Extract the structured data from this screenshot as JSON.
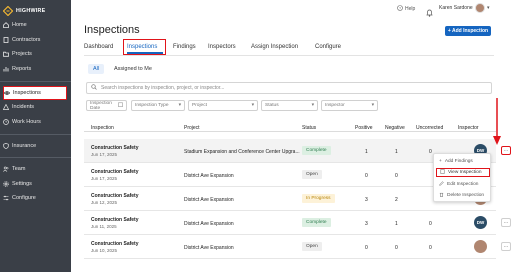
{
  "brand": {
    "name": "HIGHWIRE"
  },
  "sidebar": {
    "items": [
      {
        "label": "Home",
        "icon": "home-icon"
      },
      {
        "label": "Contractors",
        "icon": "building-icon"
      },
      {
        "label": "Projects",
        "icon": "folder-icon"
      },
      {
        "label": "Reports",
        "icon": "chart-icon"
      },
      {
        "label": "Inspections",
        "icon": "eye-icon"
      },
      {
        "label": "Incidents",
        "icon": "alert-icon"
      },
      {
        "label": "Work Hours",
        "icon": "clock-icon"
      },
      {
        "label": "Insurance",
        "icon": "shield-icon"
      },
      {
        "label": "Team",
        "icon": "users-icon"
      },
      {
        "label": "Settings",
        "icon": "gear-icon"
      },
      {
        "label": "Configure",
        "icon": "sliders-icon"
      }
    ]
  },
  "topbar": {
    "help": "Help",
    "user": "Karen Sardone"
  },
  "page": {
    "title": "Inspections",
    "add_button": "+ Add Inspection"
  },
  "tabs": [
    "Dashboard",
    "Inspections",
    "Findings",
    "Inspectors",
    "Assign Inspection",
    "Configure"
  ],
  "subtabs": [
    "All",
    "Assigned to Me"
  ],
  "search": {
    "placeholder": "Search inspections by inspection, project, or inspector..."
  },
  "filters": [
    "Inspection Date",
    "Inspection Type",
    "Project",
    "Status",
    "Inspector"
  ],
  "table": {
    "headers": [
      "Inspection",
      "Project",
      "Status",
      "Positive",
      "Negative",
      "Uncorrected",
      "Inspector"
    ],
    "rows": [
      {
        "name": "Construction Safety",
        "date": "Jun 17, 2025",
        "project": "Stadium Expansion and Conference Center Upgra...",
        "status": "Complete",
        "positive": "1",
        "negative": "1",
        "uncorrected": "0",
        "inspector": "DW"
      },
      {
        "name": "Construction Safety",
        "date": "Jun 17, 2025",
        "project": "District Ave Expansion",
        "status": "Open",
        "positive": "0",
        "negative": "0",
        "uncorrected": "",
        "inspector": ""
      },
      {
        "name": "Construction Safety",
        "date": "Jun 12, 2025",
        "project": "District Ave Expansion",
        "status": "In Progress",
        "positive": "3",
        "negative": "2",
        "uncorrected": "",
        "inspector": ""
      },
      {
        "name": "Construction Safety",
        "date": "Jun 11, 2025",
        "project": "District Ave Expansion",
        "status": "Complete",
        "positive": "3",
        "negative": "1",
        "uncorrected": "0",
        "inspector": "DW"
      },
      {
        "name": "Construction Safety",
        "date": "Jun 10, 2025",
        "project": "District Ave Expansion",
        "status": "Open",
        "positive": "0",
        "negative": "0",
        "uncorrected": "0",
        "inspector": ""
      }
    ]
  },
  "menu": {
    "items": [
      "Add Findings",
      "View Inspection",
      "Edit Inspection",
      "Delete Inspection"
    ]
  },
  "colors": {
    "sidebar": "#3a3f47",
    "accent": "#1565c0",
    "highlight": "#e0141a"
  }
}
